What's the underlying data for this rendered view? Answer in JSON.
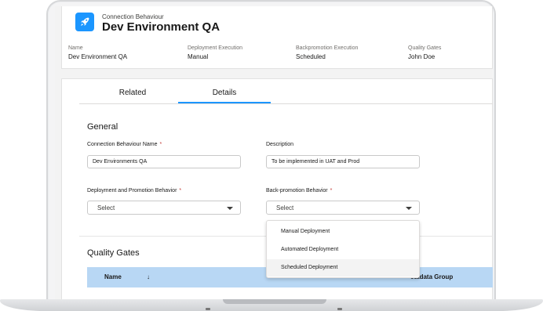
{
  "header": {
    "subtitle": "Connection Behaviour",
    "title": "Dev Environment QA",
    "fields": [
      {
        "label": "Name",
        "value": "Dev Environment QA"
      },
      {
        "label": "Deployment Execution",
        "value": "Manual"
      },
      {
        "label": "Backpromotion Execution",
        "value": "Scheduled"
      },
      {
        "label": "Quality Gates",
        "value": "John Doe"
      }
    ]
  },
  "tabs": [
    {
      "label": "Related"
    },
    {
      "label": "Details"
    }
  ],
  "general": {
    "title": "General",
    "name_label": "Connection Behaviour Name",
    "name_value": "Dev Environments QA",
    "description_label": "Description",
    "description_value": "To be implemented in UAT and Prod",
    "deploy_label": "Deployment and Promotion Behavior",
    "deploy_value": "Select",
    "back_label": "Back-promotion Behavior",
    "back_value": "Select",
    "required_mark": "*"
  },
  "dropdown": {
    "options": [
      "Manual Deployment",
      "Automated Deployment",
      "Scheduled Deployment"
    ],
    "highlighted": "Scheduled Deployment"
  },
  "quality_gates": {
    "title": "Quality Gates",
    "col_name": "Name",
    "sort_indicator": "↓",
    "col_metadata": "etadata Group"
  },
  "colors": {
    "accent": "#1b96ff",
    "table_header": "#b8d7f4",
    "required": "#c23934"
  },
  "icons": {
    "app": "rocket-icon",
    "caret": "chevron-down-icon",
    "sort": "arrow-down-icon"
  }
}
